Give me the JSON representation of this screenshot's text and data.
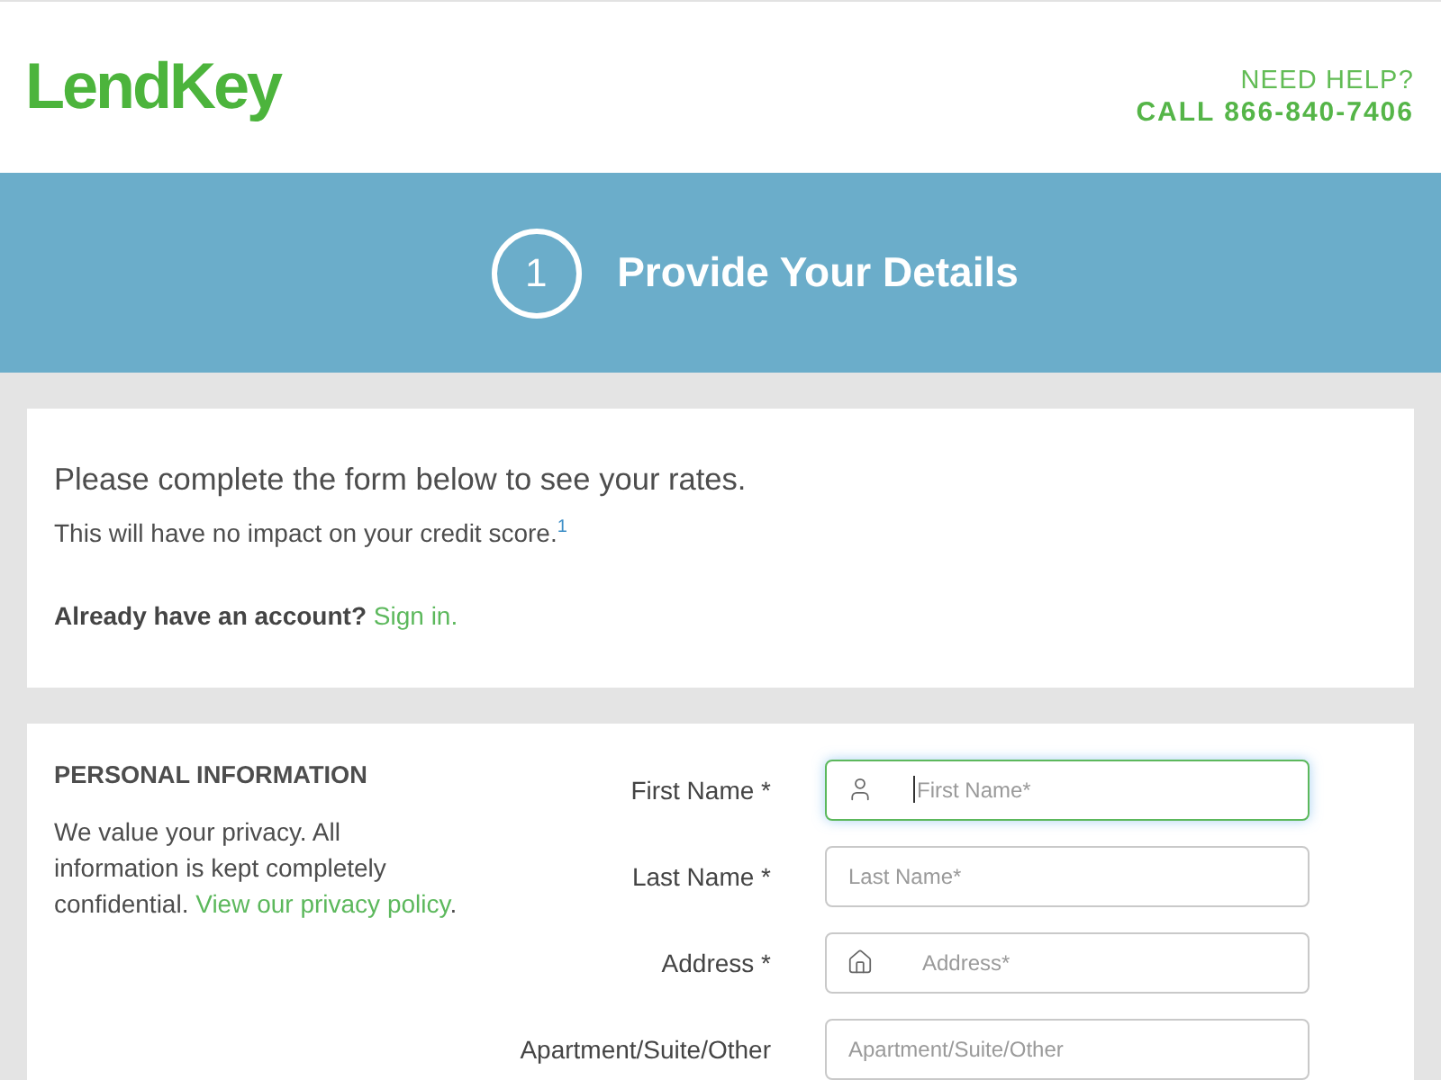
{
  "header": {
    "logo": "LendKey",
    "help_label": "NEED HELP?",
    "phone": "CALL 866-840-7406"
  },
  "banner": {
    "step": "1",
    "title": "Provide Your Details"
  },
  "intro": {
    "heading": "Please complete the form below to see your rates.",
    "note": "This will have no impact on your credit score.$^{1}$",
    "account_prompt": "Already have an account?",
    "sign_in_link": "Sign in."
  },
  "personal_info": {
    "heading": "PERSONAL INFORMATION",
    "text": "We value your privacy. All information is kept completely confidential.",
    "privacy_link": "View our privacy policy",
    "text_end": "."
  },
  "fields": [
    {
      "kind": "user",
      "label": "First Name *",
      "placeholder": "First Name*",
      "focused": true
    },
    {
      "kind": "text",
      "label": "Last Name *",
      "placeholder": "Last Name*",
      "focused": false
    },
    {
      "kind": "address",
      "label": "Address *",
      "placeholder": "Address*",
      "focused": false
    },
    {
      "kind": "text",
      "label": "Apartment/Suite/Other",
      "placeholder": "Apartment/Suite/Other",
      "focused": false
    }
  ]
}
